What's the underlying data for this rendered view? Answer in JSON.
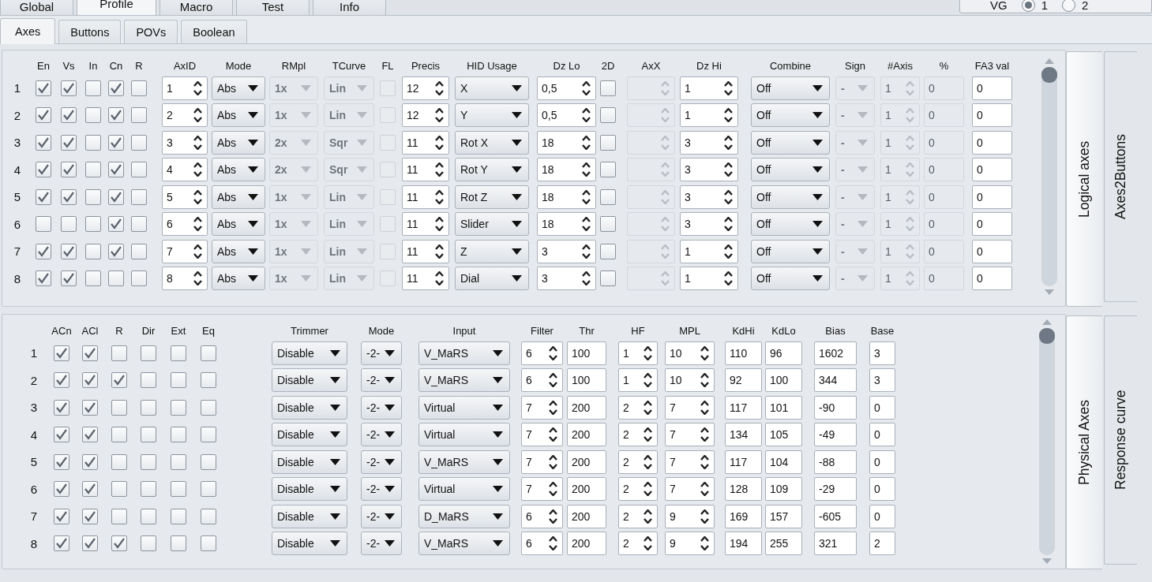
{
  "tabs": [
    {
      "label": "Global",
      "selected": false
    },
    {
      "label": "Profile",
      "selected": true
    },
    {
      "label": "Macro",
      "selected": false
    },
    {
      "label": "Test",
      "selected": false
    },
    {
      "label": "Info",
      "selected": false
    }
  ],
  "vg_selector": {
    "label": "VG",
    "options": [
      {
        "label": "1",
        "selected": true
      },
      {
        "label": "2",
        "selected": false
      }
    ]
  },
  "subtabs": [
    {
      "label": "Axes",
      "selected": true
    },
    {
      "label": "Buttons",
      "selected": false
    },
    {
      "label": "POVs",
      "selected": false
    },
    {
      "label": "Boolean",
      "selected": false
    }
  ],
  "logical_axes": {
    "columns": [
      {
        "kind": "label"
      },
      {
        "header": "En",
        "kind": "check"
      },
      {
        "header": "Vs",
        "kind": "check"
      },
      {
        "header": "In",
        "kind": "check"
      },
      {
        "header": "Cn",
        "kind": "check"
      },
      {
        "header": "R",
        "kind": "check"
      },
      {
        "header": "AxID",
        "kind": "spin"
      },
      {
        "header": "Mode",
        "kind": "combo"
      },
      {
        "header": "RMpl",
        "kind": "combo",
        "disabled": true
      },
      {
        "header": "TCurve",
        "kind": "combo",
        "disabled": true
      },
      {
        "header": "FL",
        "kind": "check",
        "disabled": true
      },
      {
        "header": "Precis",
        "kind": "spin"
      },
      {
        "header": "HID Usage",
        "kind": "combo"
      },
      {
        "header": "Dz Lo",
        "kind": "spin"
      },
      {
        "header": "2D",
        "kind": "check"
      },
      {
        "header": "AxX",
        "kind": "spin",
        "disabled": true
      },
      {
        "header": "Dz Hi",
        "kind": "spin"
      },
      {
        "header": "Combine",
        "kind": "combo"
      },
      {
        "header": "Sign",
        "kind": "combo",
        "disabled": true
      },
      {
        "header": "#Axis",
        "kind": "spin",
        "disabled": true
      },
      {
        "header": "%",
        "kind": "field",
        "disabled": true
      },
      {
        "header": "FA3 val",
        "kind": "field"
      }
    ],
    "rows": [
      {
        "cells": [
          {
            "value": "1"
          },
          {
            "checked": true
          },
          {
            "checked": true
          },
          {
            "checked": false
          },
          {
            "checked": true
          },
          {
            "checked": false
          },
          {
            "value": "1"
          },
          {
            "value": "Abs"
          },
          {
            "value": "1x"
          },
          {
            "value": "Lin"
          },
          {
            "checked": false
          },
          {
            "value": "12"
          },
          {
            "value": "X"
          },
          {
            "value": "0,5"
          },
          {
            "checked": false
          },
          {},
          {
            "value": "1"
          },
          {
            "value": "Off"
          },
          {
            "value": "-"
          },
          {
            "value": "1"
          },
          {
            "value": "0"
          },
          {
            "value": "0"
          }
        ]
      },
      {
        "cells": [
          {
            "value": "2"
          },
          {
            "checked": true
          },
          {
            "checked": true
          },
          {
            "checked": false
          },
          {
            "checked": true
          },
          {
            "checked": false
          },
          {
            "value": "2"
          },
          {
            "value": "Abs"
          },
          {
            "value": "1x"
          },
          {
            "value": "Lin"
          },
          {
            "checked": false
          },
          {
            "value": "12"
          },
          {
            "value": "Y"
          },
          {
            "value": "0,5"
          },
          {
            "checked": false
          },
          {},
          {
            "value": "1"
          },
          {
            "value": "Off"
          },
          {
            "value": "-"
          },
          {
            "value": "1"
          },
          {
            "value": "0"
          },
          {
            "value": "0"
          }
        ]
      },
      {
        "cells": [
          {
            "value": "3"
          },
          {
            "checked": true
          },
          {
            "checked": true
          },
          {
            "checked": false
          },
          {
            "checked": true
          },
          {
            "checked": false
          },
          {
            "value": "3"
          },
          {
            "value": "Abs"
          },
          {
            "value": "2x"
          },
          {
            "value": "Sqr"
          },
          {
            "checked": false
          },
          {
            "value": "11"
          },
          {
            "value": "Rot X"
          },
          {
            "value": "18"
          },
          {
            "checked": false
          },
          {},
          {
            "value": "3"
          },
          {
            "value": "Off"
          },
          {
            "value": "-"
          },
          {
            "value": "1"
          },
          {
            "value": "0"
          },
          {
            "value": "0"
          }
        ]
      },
      {
        "cells": [
          {
            "value": "4"
          },
          {
            "checked": true
          },
          {
            "checked": true
          },
          {
            "checked": false
          },
          {
            "checked": true
          },
          {
            "checked": false
          },
          {
            "value": "4"
          },
          {
            "value": "Abs"
          },
          {
            "value": "2x"
          },
          {
            "value": "Sqr"
          },
          {
            "checked": false
          },
          {
            "value": "11"
          },
          {
            "value": "Rot Y"
          },
          {
            "value": "18"
          },
          {
            "checked": false
          },
          {},
          {
            "value": "3"
          },
          {
            "value": "Off"
          },
          {
            "value": "-"
          },
          {
            "value": "1"
          },
          {
            "value": "0"
          },
          {
            "value": "0"
          }
        ]
      },
      {
        "cells": [
          {
            "value": "5"
          },
          {
            "checked": true
          },
          {
            "checked": true
          },
          {
            "checked": false
          },
          {
            "checked": true
          },
          {
            "checked": false
          },
          {
            "value": "5"
          },
          {
            "value": "Abs"
          },
          {
            "value": "1x"
          },
          {
            "value": "Lin"
          },
          {
            "checked": false
          },
          {
            "value": "11"
          },
          {
            "value": "Rot Z"
          },
          {
            "value": "18"
          },
          {
            "checked": false
          },
          {},
          {
            "value": "3"
          },
          {
            "value": "Off"
          },
          {
            "value": "-"
          },
          {
            "value": "1"
          },
          {
            "value": "0"
          },
          {
            "value": "0"
          }
        ]
      },
      {
        "cells": [
          {
            "value": "6"
          },
          {
            "checked": false
          },
          {
            "checked": false
          },
          {
            "checked": false
          },
          {
            "checked": true
          },
          {
            "checked": false
          },
          {
            "value": "6"
          },
          {
            "value": "Abs"
          },
          {
            "value": "1x"
          },
          {
            "value": "Lin"
          },
          {
            "checked": false
          },
          {
            "value": "11"
          },
          {
            "value": "Slider"
          },
          {
            "value": "18"
          },
          {
            "checked": false
          },
          {},
          {
            "value": "3"
          },
          {
            "value": "Off"
          },
          {
            "value": "-"
          },
          {
            "value": "1"
          },
          {
            "value": "0"
          },
          {
            "value": "0"
          }
        ]
      },
      {
        "cells": [
          {
            "value": "7"
          },
          {
            "checked": true
          },
          {
            "checked": true
          },
          {
            "checked": false
          },
          {
            "checked": true
          },
          {
            "checked": false
          },
          {
            "value": "7"
          },
          {
            "value": "Abs"
          },
          {
            "value": "1x"
          },
          {
            "value": "Lin"
          },
          {
            "checked": false
          },
          {
            "value": "11"
          },
          {
            "value": "Z"
          },
          {
            "value": "3"
          },
          {
            "checked": false
          },
          {},
          {
            "value": "1"
          },
          {
            "value": "Off"
          },
          {
            "value": "-"
          },
          {
            "value": "1"
          },
          {
            "value": "0"
          },
          {
            "value": "0"
          }
        ]
      },
      {
        "cells": [
          {
            "value": "8"
          },
          {
            "checked": true
          },
          {
            "checked": true
          },
          {
            "checked": false
          },
          {
            "checked": false
          },
          {
            "checked": false
          },
          {
            "value": "8"
          },
          {
            "value": "Abs"
          },
          {
            "value": "1x"
          },
          {
            "value": "Lin"
          },
          {
            "checked": false
          },
          {
            "value": "11"
          },
          {
            "value": "Dial"
          },
          {
            "value": "3"
          },
          {
            "checked": false
          },
          {},
          {
            "value": "1"
          },
          {
            "value": "Off"
          },
          {
            "value": "-"
          },
          {
            "value": "1"
          },
          {
            "value": "0"
          },
          {
            "value": "0"
          }
        ]
      }
    ]
  },
  "logical_side_tabs": [
    {
      "label": "Logical axes",
      "selected": true
    },
    {
      "label": "Axes2Buttons",
      "selected": false
    }
  ],
  "physical_axes": {
    "columns": [
      {
        "kind": "label"
      },
      {
        "header": "ACn",
        "kind": "check"
      },
      {
        "header": "ACl",
        "kind": "check"
      },
      {
        "header": "R",
        "kind": "check"
      },
      {
        "header": "Dir",
        "kind": "check"
      },
      {
        "header": "Ext",
        "kind": "check"
      },
      {
        "header": "Eq",
        "kind": "check"
      },
      {
        "header": "Trimmer",
        "kind": "combo"
      },
      {
        "header": "Mode",
        "kind": "combo"
      },
      {
        "header": "Input",
        "kind": "combo"
      },
      {
        "header": "Filter",
        "kind": "spin"
      },
      {
        "header": "Thr",
        "kind": "field"
      },
      {
        "header": "HF",
        "kind": "spin"
      },
      {
        "header": "MPL",
        "kind": "spin"
      },
      {
        "header": "KdHi",
        "kind": "field"
      },
      {
        "header": "KdLo",
        "kind": "field"
      },
      {
        "header": "Bias",
        "kind": "field"
      },
      {
        "header": "Base",
        "kind": "field"
      }
    ],
    "rows": [
      {
        "cells": [
          {
            "value": "1"
          },
          {
            "checked": true
          },
          {
            "checked": true
          },
          {
            "checked": false
          },
          {
            "checked": false
          },
          {
            "checked": false
          },
          {
            "checked": false
          },
          {
            "value": "Disable"
          },
          {
            "value": "-2-"
          },
          {
            "value": "V_MaRS"
          },
          {
            "value": "6"
          },
          {
            "value": "100"
          },
          {
            "value": "1"
          },
          {
            "value": "10"
          },
          {
            "value": "110"
          },
          {
            "value": "96"
          },
          {
            "value": "1602"
          },
          {
            "value": "3"
          }
        ]
      },
      {
        "cells": [
          {
            "value": "2"
          },
          {
            "checked": true
          },
          {
            "checked": true
          },
          {
            "checked": true
          },
          {
            "checked": false
          },
          {
            "checked": false
          },
          {
            "checked": false
          },
          {
            "value": "Disable"
          },
          {
            "value": "-2-"
          },
          {
            "value": "V_MaRS"
          },
          {
            "value": "6"
          },
          {
            "value": "100"
          },
          {
            "value": "1"
          },
          {
            "value": "10"
          },
          {
            "value": "92"
          },
          {
            "value": "100"
          },
          {
            "value": "344"
          },
          {
            "value": "3"
          }
        ]
      },
      {
        "cells": [
          {
            "value": "3"
          },
          {
            "checked": true
          },
          {
            "checked": true
          },
          {
            "checked": false
          },
          {
            "checked": false
          },
          {
            "checked": false
          },
          {
            "checked": false
          },
          {
            "value": "Disable"
          },
          {
            "value": "-2-"
          },
          {
            "value": "Virtual"
          },
          {
            "value": "7"
          },
          {
            "value": "200"
          },
          {
            "value": "2"
          },
          {
            "value": "7"
          },
          {
            "value": "117"
          },
          {
            "value": "101"
          },
          {
            "value": "-90"
          },
          {
            "value": "0"
          }
        ]
      },
      {
        "cells": [
          {
            "value": "4"
          },
          {
            "checked": true
          },
          {
            "checked": true
          },
          {
            "checked": false
          },
          {
            "checked": false
          },
          {
            "checked": false
          },
          {
            "checked": false
          },
          {
            "value": "Disable"
          },
          {
            "value": "-2-"
          },
          {
            "value": "Virtual"
          },
          {
            "value": "7"
          },
          {
            "value": "200"
          },
          {
            "value": "2"
          },
          {
            "value": "7"
          },
          {
            "value": "134"
          },
          {
            "value": "105"
          },
          {
            "value": "-49"
          },
          {
            "value": "0"
          }
        ]
      },
      {
        "cells": [
          {
            "value": "5"
          },
          {
            "checked": true
          },
          {
            "checked": true
          },
          {
            "checked": false
          },
          {
            "checked": false
          },
          {
            "checked": false
          },
          {
            "checked": false
          },
          {
            "value": "Disable"
          },
          {
            "value": "-2-"
          },
          {
            "value": "V_MaRS"
          },
          {
            "value": "7"
          },
          {
            "value": "200"
          },
          {
            "value": "2"
          },
          {
            "value": "7"
          },
          {
            "value": "117"
          },
          {
            "value": "104"
          },
          {
            "value": "-88"
          },
          {
            "value": "0"
          }
        ]
      },
      {
        "cells": [
          {
            "value": "6"
          },
          {
            "checked": true
          },
          {
            "checked": true
          },
          {
            "checked": false
          },
          {
            "checked": false
          },
          {
            "checked": false
          },
          {
            "checked": false
          },
          {
            "value": "Disable"
          },
          {
            "value": "-2-"
          },
          {
            "value": "Virtual"
          },
          {
            "value": "7"
          },
          {
            "value": "200"
          },
          {
            "value": "2"
          },
          {
            "value": "7"
          },
          {
            "value": "128"
          },
          {
            "value": "109"
          },
          {
            "value": "-29"
          },
          {
            "value": "0"
          }
        ]
      },
      {
        "cells": [
          {
            "value": "7"
          },
          {
            "checked": true
          },
          {
            "checked": true
          },
          {
            "checked": false
          },
          {
            "checked": false
          },
          {
            "checked": false
          },
          {
            "checked": false
          },
          {
            "value": "Disable"
          },
          {
            "value": "-2-"
          },
          {
            "value": "D_MaRS"
          },
          {
            "value": "6"
          },
          {
            "value": "200"
          },
          {
            "value": "2"
          },
          {
            "value": "9"
          },
          {
            "value": "169"
          },
          {
            "value": "157"
          },
          {
            "value": "-605"
          },
          {
            "value": "0"
          }
        ]
      },
      {
        "cells": [
          {
            "value": "8"
          },
          {
            "checked": true
          },
          {
            "checked": true
          },
          {
            "checked": true
          },
          {
            "checked": false
          },
          {
            "checked": false
          },
          {
            "checked": false
          },
          {
            "value": "Disable"
          },
          {
            "value": "-2-"
          },
          {
            "value": "V_MaRS"
          },
          {
            "value": "6"
          },
          {
            "value": "200"
          },
          {
            "value": "2"
          },
          {
            "value": "9"
          },
          {
            "value": "194"
          },
          {
            "value": "255"
          },
          {
            "value": "321"
          },
          {
            "value": "2"
          }
        ]
      }
    ]
  },
  "physical_side_tabs": [
    {
      "label": "Physical Axes",
      "selected": true
    },
    {
      "label": "Response curve",
      "selected": false
    }
  ]
}
